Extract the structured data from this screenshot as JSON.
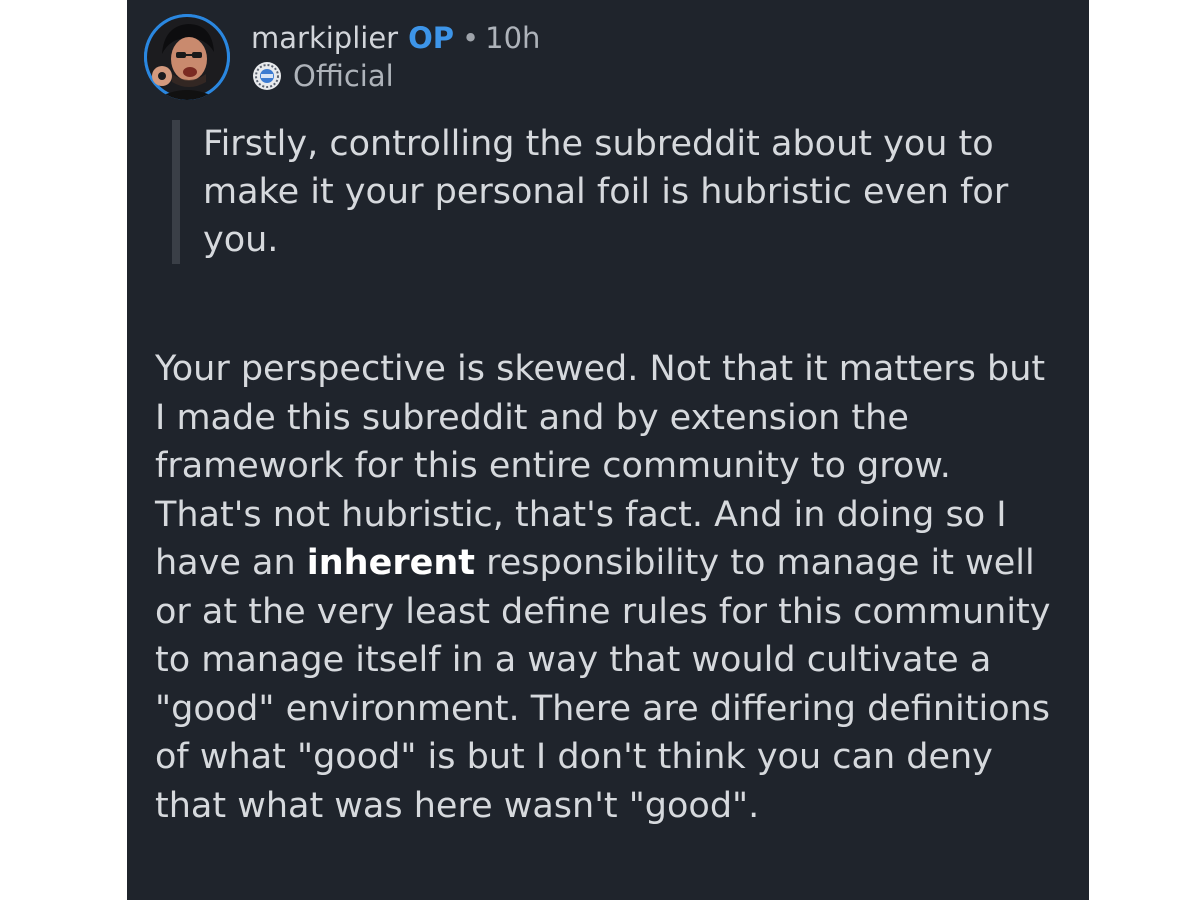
{
  "comment": {
    "author": {
      "username": "markiplier",
      "op_badge": "OP",
      "separator": "•",
      "time_ago": "10h",
      "flair_label": "Official",
      "avatar": "avatar-photo",
      "flair_icon": "official-badge-icon"
    },
    "quote_text": "Firstly, controlling the subreddit about you to make it your personal foil is hubristic even for you.",
    "body": {
      "part_before_bold": "Your perspective is skewed. Not that it matters but I made this subreddit and by extension the framework for this entire community to grow. That's not hubristic, that's fact. And in doing so I have an ",
      "bold_word": "inherent",
      "part_after_bold": " responsibility to manage it well or at the very least define rules for this community to manage itself in a way that would cultivate a \"good\" environment. There are differing definitions of what \"good\" is but I don't think you can deny that what was here wasn't \"good\"."
    }
  },
  "colors": {
    "card_background": "#1f242c",
    "text": "#d6d9dd",
    "op_accent": "#3d95e9",
    "quote_bar": "#3a3f47",
    "avatar_ring": "#2a87e0"
  }
}
